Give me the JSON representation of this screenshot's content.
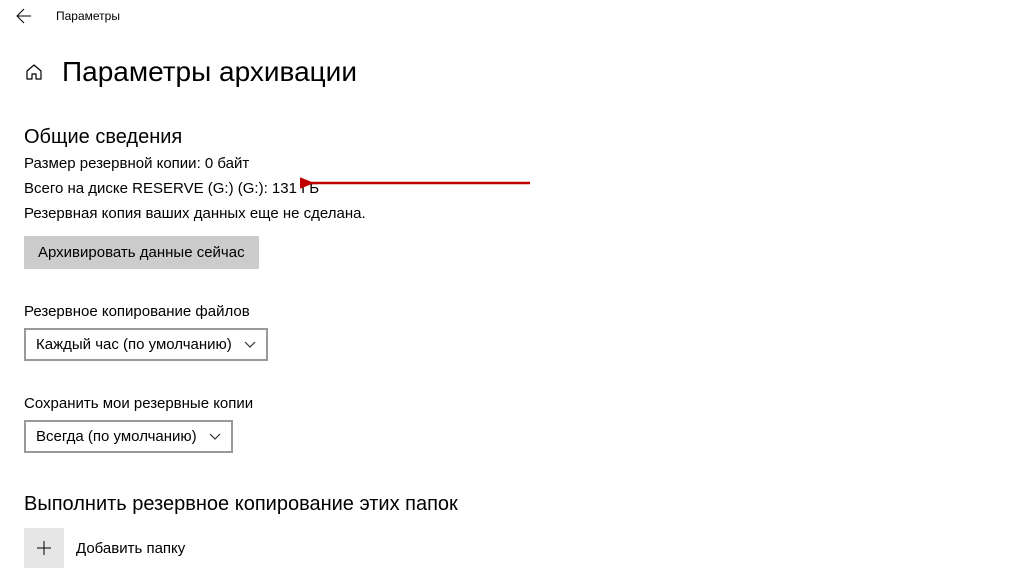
{
  "titlebar": {
    "title": "Параметры"
  },
  "header": {
    "page_title": "Параметры архивации"
  },
  "overview": {
    "heading": "Общие сведения",
    "size_line": "Размер резервной копии: 0 байт",
    "disk_line": "Всего на диске RESERVE (G:) (G:): 131 ГБ",
    "status_line": "Резервная копия ваших данных еще не сделана.",
    "backup_now_label": "Архивировать данные сейчас"
  },
  "frequency": {
    "label": "Резервное копирование файлов",
    "value": "Каждый час (по умолчанию)"
  },
  "retention": {
    "label": "Сохранить мои резервные копии",
    "value": "Всегда (по умолчанию)"
  },
  "folders": {
    "heading": "Выполнить резервное копирование этих папок",
    "add_label": "Добавить папку"
  }
}
